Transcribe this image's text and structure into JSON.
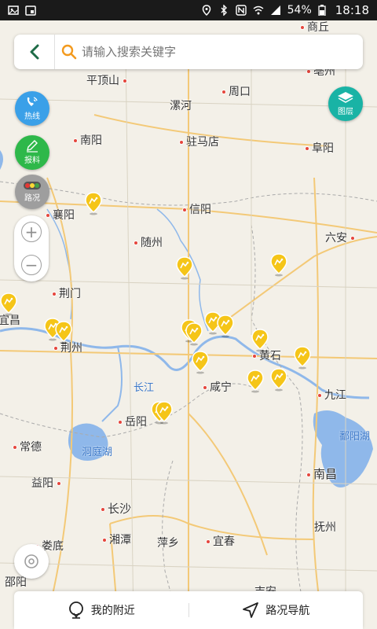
{
  "status_bar": {
    "battery": "54%",
    "time": "18:18"
  },
  "search": {
    "placeholder": "请输入搜索关键字"
  },
  "buttons": {
    "hotline": "热线",
    "report": "报料",
    "traffic": "路况",
    "layers": "图层"
  },
  "cities": [
    {
      "name": "商丘",
      "dot": true
    },
    {
      "name": "平顶山",
      "dot": true
    },
    {
      "name": "周口",
      "dot": true
    },
    {
      "name": "亳州",
      "dot": true
    },
    {
      "name": "漯河",
      "dot": false
    },
    {
      "name": "南阳",
      "dot": true
    },
    {
      "name": "驻马店",
      "dot": true
    },
    {
      "name": "阜阳",
      "dot": true
    },
    {
      "name": "襄阳",
      "dot": true
    },
    {
      "name": "信阳",
      "dot": true
    },
    {
      "name": "随州",
      "dot": true
    },
    {
      "name": "六安",
      "dot": true
    },
    {
      "name": "荆门",
      "dot": true
    },
    {
      "name": "宜昌",
      "dot": true
    },
    {
      "name": "荆州",
      "dot": true
    },
    {
      "name": "黄石",
      "dot": true
    },
    {
      "name": "咸宁",
      "dot": true
    },
    {
      "name": "九江",
      "dot": true
    },
    {
      "name": "岳阳",
      "dot": true
    },
    {
      "name": "常德",
      "dot": true
    },
    {
      "name": "南昌",
      "dot": true
    },
    {
      "name": "益阳",
      "dot": true
    },
    {
      "name": "长沙",
      "dot": true
    },
    {
      "name": "抚州",
      "dot": true
    },
    {
      "name": "湘潭",
      "dot": true
    },
    {
      "name": "萍乡",
      "dot": true
    },
    {
      "name": "宜春",
      "dot": true
    },
    {
      "name": "娄底",
      "dot": true
    },
    {
      "name": "邵阳",
      "dot": true
    },
    {
      "name": "吉安",
      "dot": true
    }
  ],
  "water_labels": [
    "长江",
    "洞庭湖",
    "鄱阳湖"
  ],
  "bottom_bar": {
    "nearby": "我的附近",
    "navigation": "路况导航"
  },
  "colors": {
    "hotline": "#3aa0e8",
    "report": "#2eb84a",
    "traffic": "#9e9e9e",
    "layers": "#19b3a5",
    "marker": "#f5c518",
    "city_dot": "#e5463c"
  }
}
